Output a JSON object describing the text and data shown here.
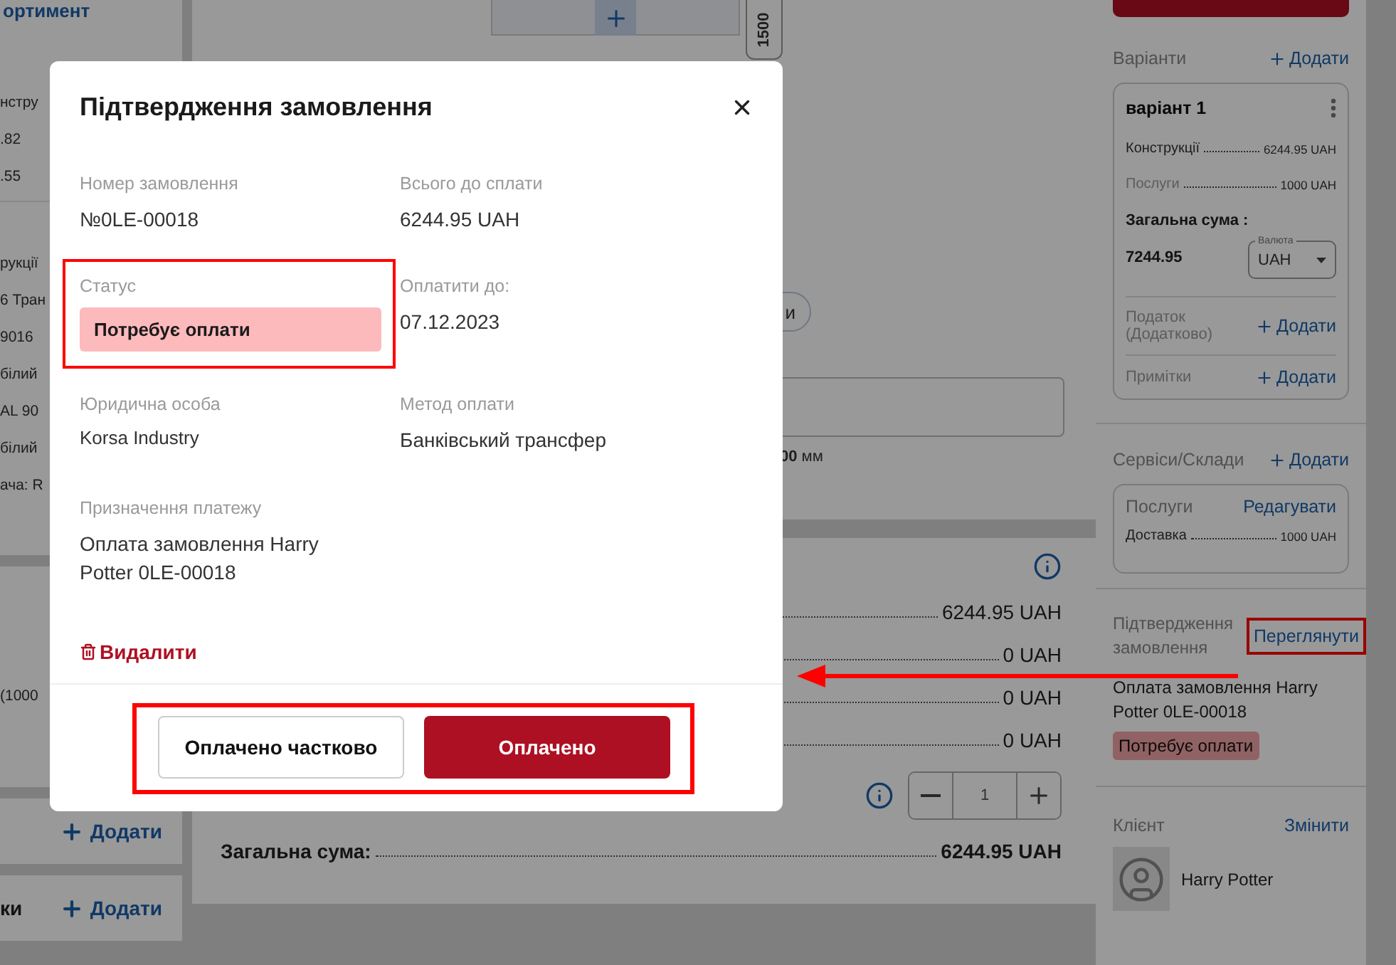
{
  "left_panel": {
    "top_link": "ортимент",
    "groups": [
      [
        "нстру",
        ".82",
        ".55"
      ],
      [
        "рукції",
        "6 Тран",
        "9016",
        "білий",
        "AL 90",
        "білий",
        "ача: R"
      ],
      [
        "(1000"
      ]
    ],
    "sections": [
      {
        "add": "Додати"
      },
      {
        "title": "ки",
        "add": "Додати"
      }
    ]
  },
  "middle": {
    "ruler_label": "1500",
    "chip_text": "и",
    "dimension": "**00** мм",
    "totals": {
      "rows": [
        "6244.95 UAH",
        "0 UAH",
        "0 UAH",
        "0 UAH"
      ],
      "quantity": "1",
      "total_label": "Загальна сума:",
      "total_value": "6244.95 UAH"
    }
  },
  "right_panel": {
    "variants": {
      "title": "Варіанти",
      "add": "Додати",
      "card": {
        "name": "варіант 1",
        "lines": [
          {
            "label": "Конструкції",
            "value": "6244.95 UAH",
            "muted": false
          },
          {
            "label": "Послуги",
            "value": "1000 UAH",
            "muted": true
          }
        ],
        "total_label": "Загальна сума :",
        "total_value": "7244.95",
        "currency": {
          "label": "Валюта",
          "value": "UAH"
        },
        "extras": [
          {
            "label": "Податок (Додатково)",
            "add": "Додати"
          },
          {
            "label": "Примітки",
            "add": "Додати"
          }
        ]
      }
    },
    "services": {
      "title": "Сервіси/Склади",
      "add": "Додати",
      "card": {
        "title": "Послуги",
        "action": "Редагувати",
        "lines": [
          {
            "label": "Доставка",
            "value": "1000 UAH"
          }
        ]
      }
    },
    "confirmation": {
      "title": "Підтвердження замовлення",
      "action": "Переглянути",
      "highlighted": true,
      "pointer_arrow": true,
      "purpose": "Оплата замовлення Harry Potter 0LE-00018",
      "status": "Потребує оплати"
    },
    "client": {
      "title": "Клієнт",
      "action": "Змінити",
      "name": "Harry Potter"
    }
  },
  "modal": {
    "title": "Підтвердження замовлення",
    "fields": [
      {
        "label": "Номер замовлення",
        "value": "№0LE-00018",
        "kind": "text",
        "highlighted": false
      },
      {
        "label": "Всього до сплати",
        "value": "6244.95 UAH",
        "kind": "text",
        "highlighted": false
      },
      {
        "label": "Статус",
        "value": "Потребує оплати",
        "kind": "badge",
        "highlighted": true
      },
      {
        "label": "Оплатити до:",
        "value": "07.12.2023",
        "kind": "text",
        "highlighted": false
      },
      {
        "label": "Юридична особа",
        "value": "Korsa Industry",
        "kind": "small",
        "highlighted": false
      },
      {
        "label": "Метод оплати",
        "value": "Банківський трансфер",
        "kind": "text",
        "highlighted": false
      },
      {
        "label": "Призначення платежу",
        "value": "Оплата замовлення Harry Potter 0LE-00018",
        "kind": "text",
        "highlighted": false
      }
    ],
    "delete": "Видалити",
    "buttons_highlighted": true,
    "buttons": [
      {
        "label": "Оплачено частково",
        "kind": "secondary"
      },
      {
        "label": "Оплачено",
        "kind": "primary"
      }
    ]
  }
}
